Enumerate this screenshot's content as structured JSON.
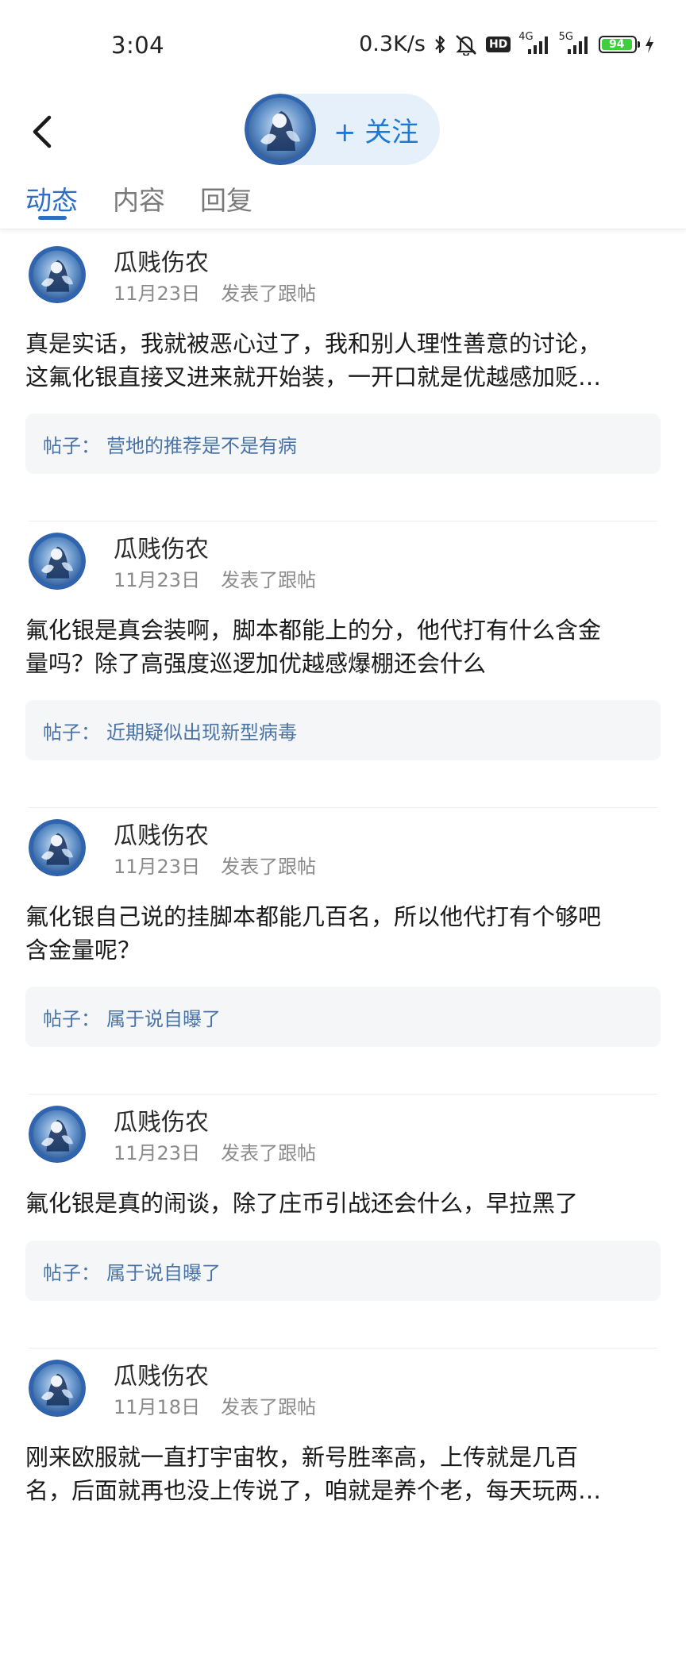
{
  "status_bar": {
    "time": "3:04",
    "net_speed": "0.3K/s",
    "hd_label": "HD",
    "sim1_label": "4G",
    "sim2_label": "5G",
    "battery_level": "94",
    "battery_percent": 94,
    "icons": [
      "bluetooth-icon",
      "mute-icon",
      "signal-icon",
      "charging-icon"
    ]
  },
  "header": {
    "back_icon": "chevron-left-icon",
    "follow_label": "+ 关注"
  },
  "tabs": [
    {
      "label": "动态",
      "active": true
    },
    {
      "label": "内容",
      "active": false
    },
    {
      "label": "回复",
      "active": false
    }
  ],
  "posts": [
    {
      "author": "瓜贱伤农",
      "date": "11月23日",
      "action": "发表了跟帖",
      "text_lines": [
        "真是实话，我就被恶心过了，我和别人理性善意的讨论，",
        "这氟化银直接叉进来就开始装，一开口就是优越感加贬…"
      ],
      "thread_label": "帖子：",
      "thread_title": "营地的推荐是不是有病"
    },
    {
      "author": "瓜贱伤农",
      "date": "11月23日",
      "action": "发表了跟帖",
      "text_lines": [
        "氟化银是真会装啊，脚本都能上的分，他代打有什么含金",
        "量吗？除了高强度巡逻加优越感爆棚还会什么"
      ],
      "thread_label": "帖子：",
      "thread_title": "近期疑似出现新型病毒"
    },
    {
      "author": "瓜贱伤农",
      "date": "11月23日",
      "action": "发表了跟帖",
      "text_lines": [
        "氟化银自己说的挂脚本都能几百名，所以他代打有个够吧",
        "含金量呢？"
      ],
      "thread_label": "帖子：",
      "thread_title": "属于说自曝了"
    },
    {
      "author": "瓜贱伤农",
      "date": "11月23日",
      "action": "发表了跟帖",
      "text_lines": [
        "氟化银是真的闹谈，除了庄币引战还会什么，早拉黑了"
      ],
      "thread_label": "帖子：",
      "thread_title": "属于说自曝了"
    },
    {
      "author": "瓜贱伤农",
      "date": "11月18日",
      "action": "发表了跟帖",
      "text_lines": [
        "刚来欧服就一直打宇宙牧，新号胜率高，上传就是几百",
        "名，后面就再也没上传说了，咱就是养个老，每天玩两…"
      ],
      "thread_label": "",
      "thread_title": ""
    }
  ]
}
